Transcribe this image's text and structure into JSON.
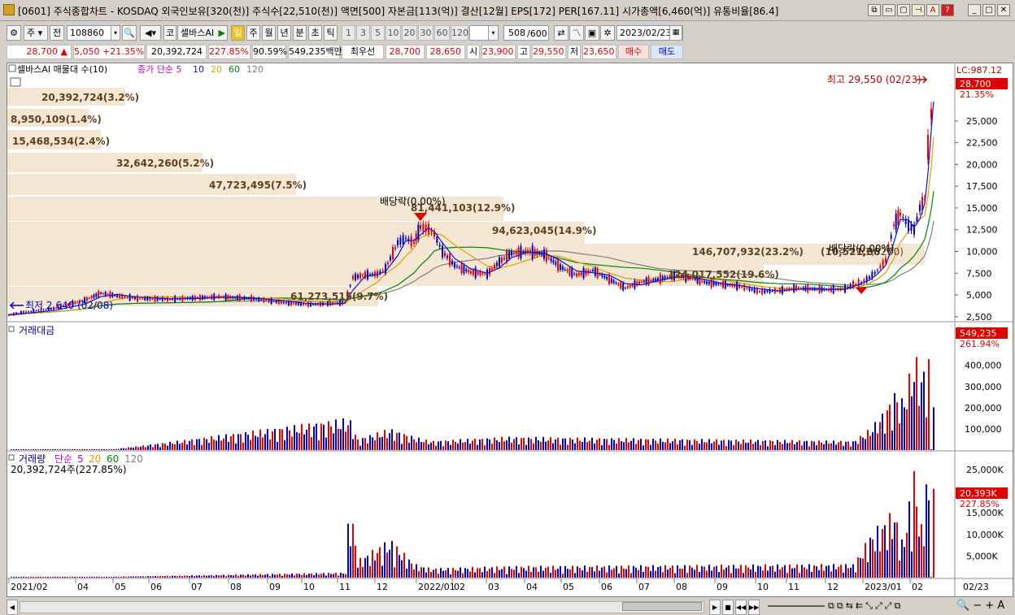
{
  "window": {
    "title": "[0601] 주식종합차트 - KOSDAQ 외국인보유[320(천)] 주식수[22,510(천)] 액면[500] 자본금[113(억)] 결산[12월] EPS[172] PER[167.11] 시가총액[6,460(억)] 유통비율[86.4]"
  },
  "toolbar": {
    "period_select": "주",
    "prev_label": "전",
    "stock_code": "108860",
    "market_label": "코",
    "stock_name": "셀바스AI",
    "intervals": [
      "일",
      "주",
      "월",
      "년",
      "분",
      "초",
      "틱"
    ],
    "minute_presets": [
      "1",
      "3",
      "5",
      "10",
      "20",
      "30",
      "60",
      "120"
    ],
    "count_value": "508",
    "count_total": "/600",
    "date_value": "2023/02/23"
  },
  "quote": {
    "price": "28,700",
    "change": "5,050",
    "change_pct": "+21.35%",
    "volume": "20,392,724",
    "volume_ratio": "227.85%",
    "ratio2": "90.59%",
    "amount": "549,235백만",
    "best_ask_label": "최우선",
    "ask": "28,700",
    "bid": "28,650",
    "open_label": "시",
    "open": "23,900",
    "high_label": "고",
    "high": "29,550",
    "low_label": "저",
    "low": "23,650",
    "buy_label": "매수",
    "sell_label": "매도"
  },
  "colors": {
    "up": "#e60000",
    "down": "#0000cc",
    "ma5": "#cc00cc",
    "ma10": "#1010d0",
    "ma20": "#e0a000",
    "ma60": "#008800",
    "ma120": "#808080",
    "band": "#f3e6d3"
  },
  "price_panel": {
    "legend_series": "셀바스AI 매물대 수(10)",
    "ma_labels": [
      "종가 단순",
      "5",
      "10",
      "20",
      "60",
      "120"
    ],
    "lc_label": "LC:987.12",
    "current_price_tag": "28,700",
    "current_pct_tag": "21.35%",
    "high_annotation": "최고 29,550 (02/23)",
    "low_annotation": "최저 2,640 (02/08)",
    "dividend_label_1": "배당락(0.00%)",
    "dividend_label_2": "배당락(0.00%)",
    "y_ticks": [
      "25,000",
      "22,500",
      "20,000",
      "17,500",
      "15,000",
      "12,500",
      "10,000",
      "7,500",
      "5,000",
      "2,500"
    ],
    "volume_profile": [
      {
        "label": "20,392,724(3.2%)",
        "share": 3.2
      },
      {
        "label": "8,950,109(1.4%)",
        "share": 1.4
      },
      {
        "label": "15,468,534(2.4%)",
        "share": 2.4
      },
      {
        "label": "32,642,260(5.2%)",
        "share": 5.2
      },
      {
        "label": "47,723,495(7.5%)",
        "share": 7.5
      },
      {
        "label": "81,441,103(12.9%)",
        "share": 12.9
      },
      {
        "label": "94,623,045(14.9%)",
        "share": 14.9
      },
      {
        "label": "146,707,932(23.2%)",
        "share": 23.2
      },
      {
        "label": "124,017,552(19.6%)",
        "share": 19.6
      },
      {
        "label": "61,273,515(9.7%)",
        "share": 9.7
      }
    ],
    "extra_label": "(10,521,86",
    "extra_label_2": "(1,32",
    "extra_label_3": "00)"
  },
  "amount_panel": {
    "title": "거래대금",
    "last_value_tag": "549,235",
    "last_pct_tag": "261.94%",
    "y_ticks": [
      "400,000",
      "300,000",
      "200,000",
      "100,000"
    ]
  },
  "volume_panel": {
    "title": "거래량",
    "ma_labels": [
      "단순",
      "5",
      "20",
      "60",
      "120"
    ],
    "current": "20,392,724주(227.85%)",
    "last_value_tag": "20,393K",
    "last_pct_tag": "227.85%",
    "y_ticks": [
      "25,000K",
      "20,000K",
      "15,000K",
      "10,000K",
      "5,000K"
    ]
  },
  "x_axis": {
    "labels": [
      "2021/02",
      "04",
      "05",
      "06",
      "07",
      "08",
      "09",
      "10",
      "11",
      "12",
      "2022/01",
      "02",
      "03",
      "04",
      "05",
      "06",
      "07",
      "08",
      "09",
      "10",
      "11",
      "12",
      "2023/01",
      "02"
    ],
    "last_date": "02/23"
  },
  "chart_data": {
    "type": "candlestick",
    "x_label_positions_note": "monthly tick labels",
    "series": [
      {
        "name": "종가",
        "x": [
          "2021/02",
          "2021/04",
          "2021/05",
          "2021/06",
          "2021/07",
          "2021/08",
          "2021/09",
          "2021/10",
          "2021/11",
          "2021/12",
          "2022/01",
          "2022/02",
          "2022/03",
          "2022/04",
          "2022/05",
          "2022/06",
          "2022/07",
          "2022/08",
          "2022/09",
          "2022/10",
          "2022/11",
          "2022/12",
          "2023/01",
          "2023/02"
        ],
        "values": [
          2700,
          4800,
          4600,
          4500,
          4800,
          4700,
          4300,
          3900,
          7500,
          11000,
          12000,
          7500,
          9500,
          9700,
          8000,
          6400,
          7000,
          7300,
          6500,
          5400,
          5700,
          6100,
          9000,
          28700
        ]
      }
    ],
    "ylim": [
      2500,
      30000
    ],
    "high": 29550,
    "low": 2640
  }
}
